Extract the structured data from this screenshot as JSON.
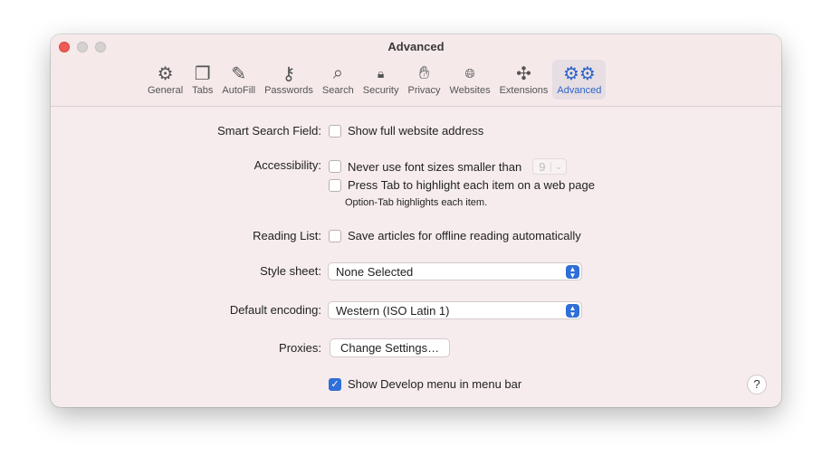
{
  "window": {
    "title": "Advanced"
  },
  "toolbar": {
    "tabs": [
      {
        "label": "General",
        "icon": "gear-icon",
        "glyph": "⚙"
      },
      {
        "label": "Tabs",
        "icon": "tabs-icon",
        "glyph": "❐"
      },
      {
        "label": "AutoFill",
        "icon": "autofill-icon",
        "glyph": "✎"
      },
      {
        "label": "Passwords",
        "icon": "key-icon",
        "glyph": "⚷"
      },
      {
        "label": "Search",
        "icon": "search-icon",
        "glyph": "⌕"
      },
      {
        "label": "Security",
        "icon": "lock-icon",
        "glyph": "🔒︎"
      },
      {
        "label": "Privacy",
        "icon": "hand-icon",
        "glyph": "✋︎"
      },
      {
        "label": "Websites",
        "icon": "globe-icon",
        "glyph": "🌐︎"
      },
      {
        "label": "Extensions",
        "icon": "puzzle-icon",
        "glyph": "✣"
      },
      {
        "label": "Advanced",
        "icon": "gears-icon",
        "glyph": "⚙⚙",
        "active": true
      }
    ]
  },
  "settings": {
    "smart_search": {
      "label": "Smart Search Field:",
      "option": "Show full website address",
      "checked": false
    },
    "accessibility": {
      "label": "Accessibility:",
      "option1": "Never use font sizes smaller than",
      "font_size": "9",
      "option2": "Press Tab to highlight each item on a web page",
      "hint": "Option-Tab highlights each item."
    },
    "reading_list": {
      "label": "Reading List:",
      "option": "Save articles for offline reading automatically"
    },
    "style_sheet": {
      "label": "Style sheet:",
      "value": "None Selected"
    },
    "encoding": {
      "label": "Default encoding:",
      "value": "Western (ISO Latin 1)"
    },
    "proxies": {
      "label": "Proxies:",
      "button": "Change Settings…"
    },
    "develop": {
      "option": "Show Develop menu in menu bar",
      "checked": true
    },
    "help": "?"
  },
  "colors": {
    "accent": "#2f6fd8"
  }
}
